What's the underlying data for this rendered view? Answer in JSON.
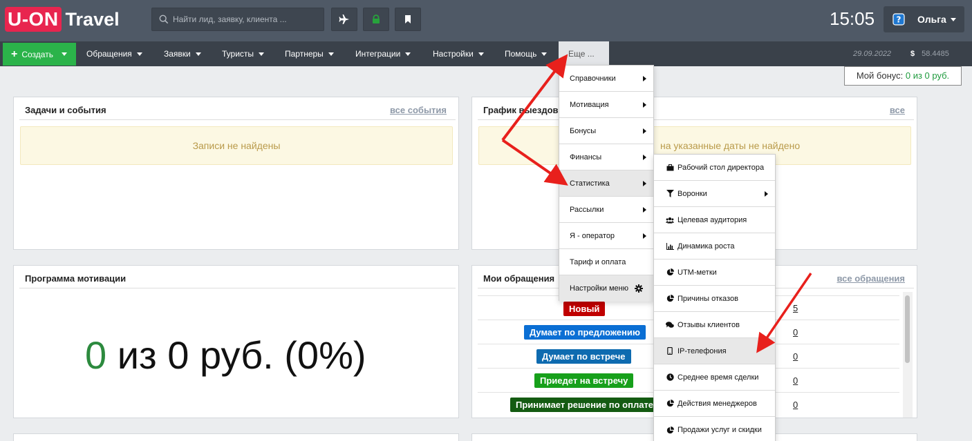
{
  "header": {
    "logo_part1": "U-ON",
    "logo_part2": "Travel",
    "search_placeholder": "Найти лид, заявку, клиента ...",
    "time": "15:05",
    "user_name": "Ольга"
  },
  "nav": {
    "create_label": "Создать",
    "items": [
      "Обращения",
      "Заявки",
      "Туристы",
      "Партнеры",
      "Интеграции",
      "Настройки",
      "Помощь"
    ],
    "more_label": "Еще ...",
    "date": "29.09.2022",
    "currency_symbol": "$",
    "rate": "58.4485"
  },
  "bonus": {
    "label": "Мой бонус:",
    "value": "0 из 0 руб."
  },
  "panels": {
    "tasks": {
      "title": "Задачи и события",
      "link": "все события",
      "empty": "Записи не найдены"
    },
    "schedule": {
      "title": "График выездов",
      "link": "все",
      "empty": "на указанные даты не найдено"
    },
    "motivation": {
      "title": "Программа мотивации",
      "zero": "0",
      "rest": "из 0 руб. (0%)"
    },
    "requests": {
      "title": "Мои обращения",
      "link": "все обращения",
      "rows": [
        {
          "status": "Новый",
          "color": "#c00000",
          "count": "5"
        },
        {
          "status": "Думает по предложению",
          "color": "#0b6fd4",
          "count": "0"
        },
        {
          "status": "Думает по встрече",
          "color": "#0e6bb0",
          "count": "0"
        },
        {
          "status": "Приедет на встречу",
          "color": "#17a01b",
          "count": "0"
        },
        {
          "status": "Принимает решение по оплате",
          "color": "#145b12",
          "count": "0"
        }
      ]
    }
  },
  "menu_more": [
    {
      "label": "Справочники",
      "submenu": true
    },
    {
      "label": "Мотивация",
      "submenu": true
    },
    {
      "label": "Бонусы",
      "submenu": true
    },
    {
      "label": "Финансы",
      "submenu": true
    },
    {
      "label": "Статистика",
      "submenu": true,
      "active": true
    },
    {
      "label": "Рассылки",
      "submenu": true
    },
    {
      "label": "Я - оператор",
      "submenu": true
    },
    {
      "label": "Тариф и оплата",
      "submenu": false
    },
    {
      "label": "Настройки меню",
      "submenu": false,
      "active": true,
      "gear": true
    }
  ],
  "menu_stats": [
    {
      "label": "Рабочий стол директора",
      "icon": "briefcase-icon"
    },
    {
      "label": "Воронки",
      "icon": "filter-icon",
      "submenu": true
    },
    {
      "label": "Целевая аудитория",
      "icon": "users-icon"
    },
    {
      "label": "Динамика роста",
      "icon": "bar-chart-icon"
    },
    {
      "label": "UTM-метки",
      "icon": "pie-chart-icon"
    },
    {
      "label": "Причины отказов",
      "icon": "pie-chart-icon"
    },
    {
      "label": "Отзывы клиентов",
      "icon": "comments-icon"
    },
    {
      "label": "IP-телефония",
      "icon": "mobile-phone-icon",
      "active": true
    },
    {
      "label": "Среднее время сделки",
      "icon": "clock-icon"
    },
    {
      "label": "Действия менеджеров",
      "icon": "pie-chart-icon"
    },
    {
      "label": "Продажи услуг и скидки",
      "icon": "pie-chart-icon"
    }
  ],
  "colors": {
    "header_bg": "#4f5966",
    "nav_bg": "#3a414a",
    "create_green": "#2bb34a",
    "logo_red": "#e8254f",
    "annotation_arrow": "#e8201c"
  }
}
